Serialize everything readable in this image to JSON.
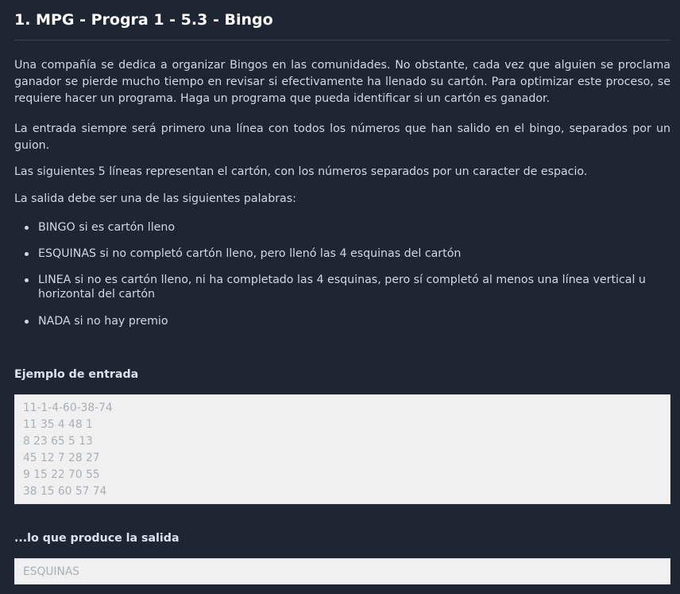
{
  "title": "1. MPG - Progra 1 - 5.3 - Bingo",
  "description": {
    "p1": "Una compañía se dedica a organizar Bingos en las comunidades. No obstante, cada vez que alguien se proclama ganador se pierde mucho tiempo en revisar si efectivamente ha llenado su cartón. Para optimizar este proceso, se requiere hacer un programa. Haga un programa que pueda identificar si un cartón es ganador.",
    "p2": "La entrada siempre será primero una línea con todos los números que han salido en el bingo, separados por un guion.",
    "p3": "Las siguientes 5 líneas representan el cartón, con los números separados por un caracter de espacio.",
    "p4": "La salida debe ser una de las siguientes palabras:"
  },
  "bullets": [
    "BINGO si es cartón lleno",
    "ESQUINAS si no completó cartón lleno, pero llenó las 4 esquinas del cartón",
    "LINEA si no es cartón lleno, ni ha completado las 4 esquinas, pero sí completó al menos una línea vertical u horizontal del cartón",
    "NADA si no hay premio"
  ],
  "example_input": {
    "heading": "Ejemplo de entrada",
    "lines": [
      "11-1-4-60-38-74",
      "11 35 4 48 1",
      "8 23 65 5 13",
      "45 12 7 28 27",
      "9 15 22 70 55",
      "38 15 60 57 74"
    ]
  },
  "example_output": {
    "heading": "...lo que produce la salida",
    "lines": [
      "ESQUINAS"
    ]
  },
  "colors": {
    "background": "#1f2633",
    "text": "#d2d8e0",
    "title": "#ffffff",
    "io_box_bg": "#f0f0f0",
    "io_box_text": "#a9afb6"
  }
}
